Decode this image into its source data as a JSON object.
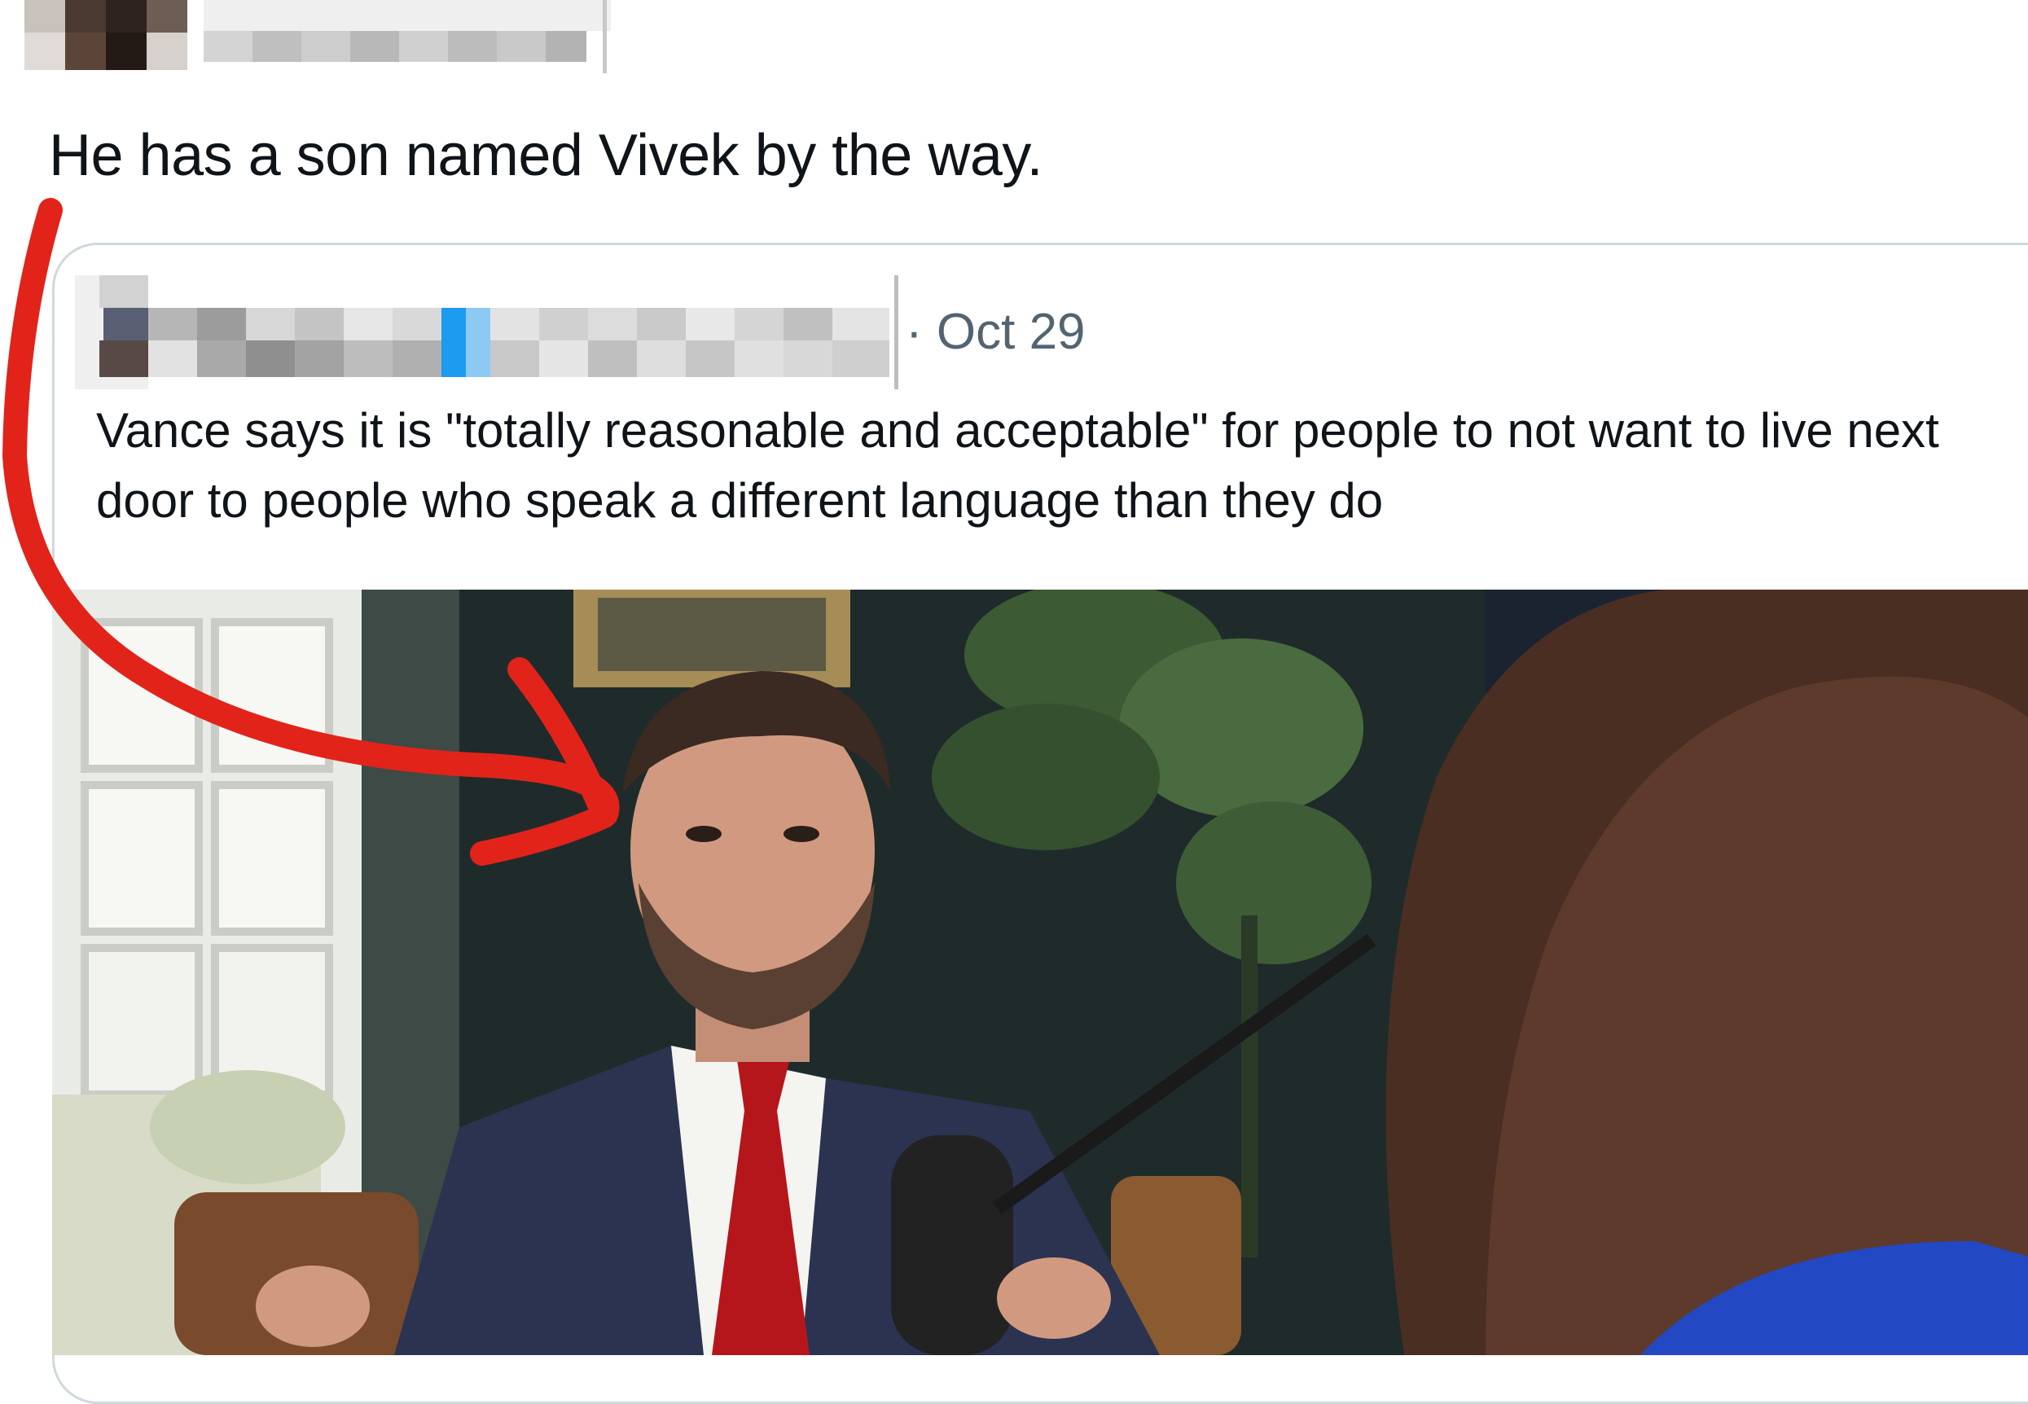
{
  "tweet": {
    "author": {
      "avatar_icon": "pixelated-avatar-icon",
      "name_censored": true
    },
    "text": "He has a son named Vivek by the way."
  },
  "quoted_tweet": {
    "author": {
      "name_censored": true
    },
    "date_prefix": "·",
    "date": "Oct 29",
    "text": "Vance says it is \"totally reasonable and acceptable\" for people to not want to live next door to people who speak a different language than they do",
    "media": {
      "type": "video-still",
      "description_icon": "interview-photo-icon"
    }
  },
  "annotation": {
    "arrow_icon": "red-arrow-icon",
    "color": "#e2231a"
  },
  "colors": {
    "text": "#0f1419",
    "secondary": "#536471",
    "border": "#cfd9de",
    "verified_blue": "#1d9bf0"
  }
}
